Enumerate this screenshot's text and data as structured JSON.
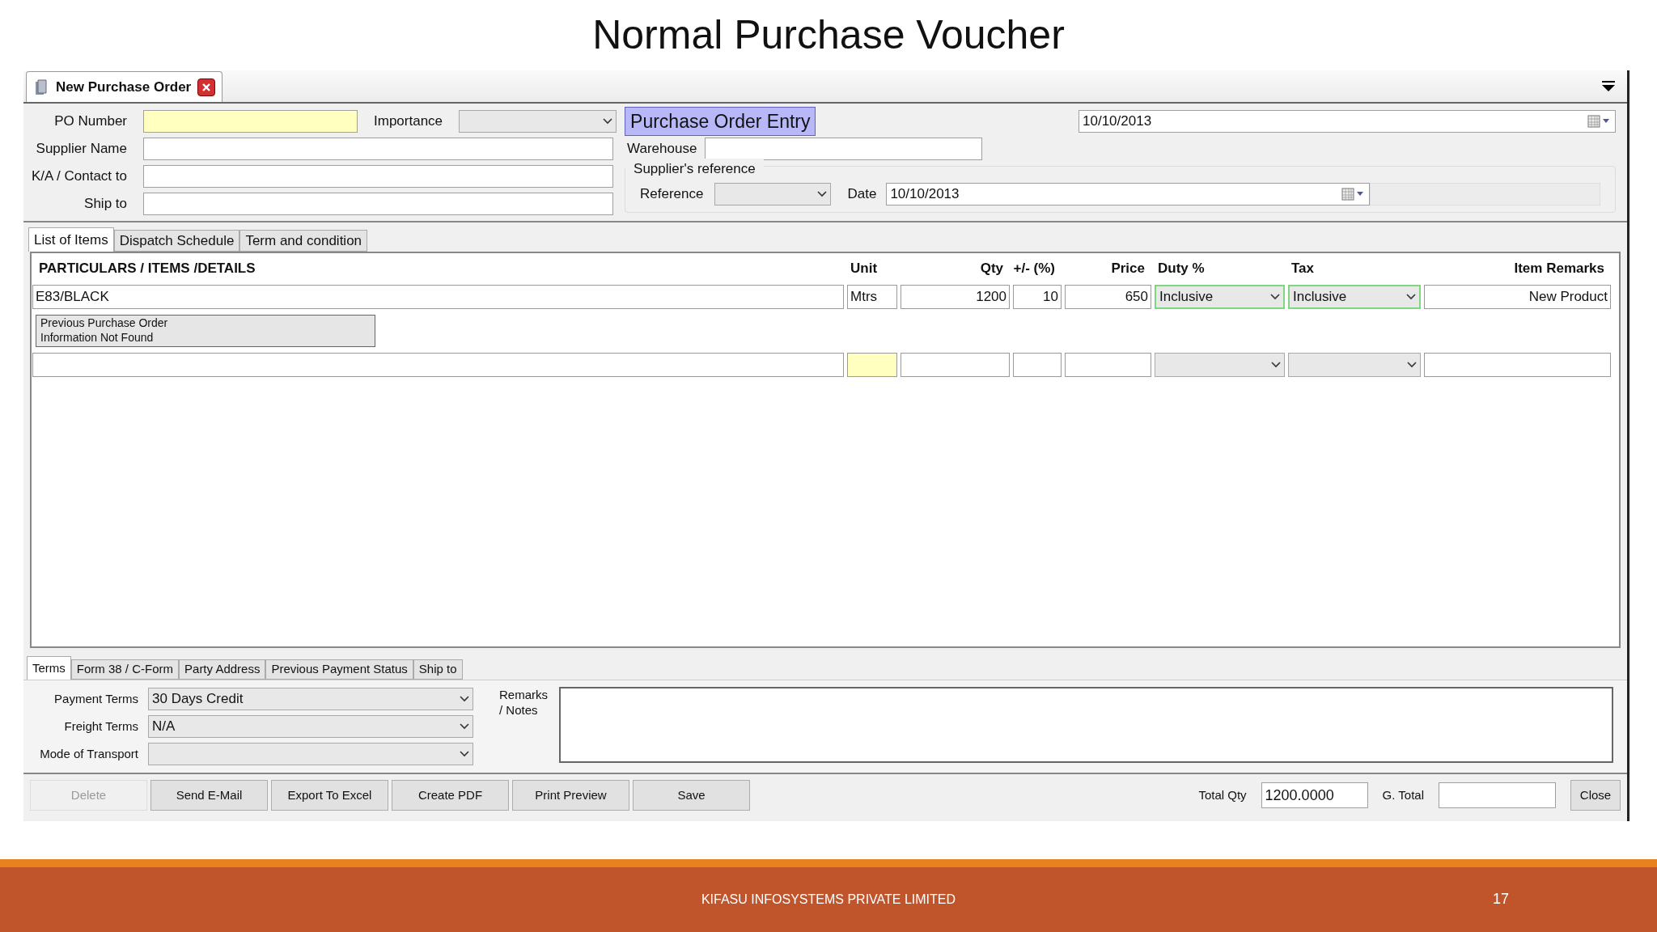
{
  "title": "Normal Purchase Voucher",
  "window": {
    "tab_title": "New Purchase Order"
  },
  "header": {
    "po_number": {
      "label": "PO Number",
      "required": true
    },
    "importance": {
      "label": "Importance"
    },
    "banner": "Purchase Order Entry",
    "order_date": "10/10/2013",
    "supplier_name": {
      "label": "Supplier Name"
    },
    "warehouse": {
      "label": "Warehouse"
    },
    "contact": {
      "label": "K/A / Contact to"
    },
    "ship_to": {
      "label": "Ship to"
    },
    "suppliers_reference": {
      "legend": "Supplier's reference",
      "reference_label": "Reference",
      "date_label": "Date",
      "date": "10/10/2013"
    }
  },
  "item_tabs": [
    {
      "label": "List of Items",
      "selected": true
    },
    {
      "label": "Dispatch Schedule",
      "selected": false
    },
    {
      "label": "Term and condition",
      "selected": false
    }
  ],
  "table": {
    "columns": [
      {
        "label": "PARTICULARS / ITEMS /DETAILS",
        "kind": "text"
      },
      {
        "label": "Unit",
        "kind": "text"
      },
      {
        "label": "Qty",
        "kind": "text"
      },
      {
        "label": "+/- (%)",
        "kind": "text"
      },
      {
        "label": "Price",
        "kind": "text"
      },
      {
        "label": "Duty %",
        "kind": "select"
      },
      {
        "label": "Tax",
        "kind": "select"
      },
      {
        "label": "Item Remarks",
        "kind": "text"
      }
    ],
    "rows": [
      {
        "cells": [
          {
            "value": "E83/BLACK"
          },
          {
            "value": "Mtrs"
          },
          {
            "value": "1200"
          },
          {
            "value": "10"
          },
          {
            "value": "650"
          },
          {
            "value": "Inclusive",
            "highlighted": true
          },
          {
            "value": "Inclusive",
            "highlighted": true
          },
          {
            "value": "New Product"
          }
        ],
        "notice": "Previous Purchase Order\nInformation Not Found"
      },
      {
        "cells": [
          {},
          {
            "required": true
          },
          {},
          {},
          {},
          {},
          {},
          {}
        ]
      }
    ]
  },
  "terms_tabs": [
    {
      "label": "Terms",
      "selected": true
    },
    {
      "label": "Form 38 / C-Form",
      "selected": false
    },
    {
      "label": "Party Address",
      "selected": false
    },
    {
      "label": "Previous Payment Status",
      "selected": false
    },
    {
      "label": "Ship to",
      "selected": false
    }
  ],
  "terms": [
    {
      "label": "Payment Terms",
      "value": "30 Days Credit"
    },
    {
      "label": "Freight Terms",
      "value": "N/A"
    },
    {
      "label": "Mode of Transport"
    }
  ],
  "remarks_label": "Remarks\n/ Notes",
  "buttons": [
    {
      "label": "Delete",
      "disabled": true
    },
    {
      "label": "Send E-Mail",
      "disabled": false
    },
    {
      "label": "Export To Excel",
      "disabled": false
    },
    {
      "label": "Create PDF",
      "disabled": false
    },
    {
      "label": "Print Preview",
      "disabled": false
    },
    {
      "label": "Save",
      "disabled": false
    }
  ],
  "totals": {
    "total_qty_label": "Total Qty",
    "total_qty": "1200.0000",
    "g_total_label": "G. Total"
  },
  "close_button": "Close",
  "footer": {
    "company": "KIFASU INFOSYSTEMS PRIVATE LIMITED",
    "page": "17"
  }
}
